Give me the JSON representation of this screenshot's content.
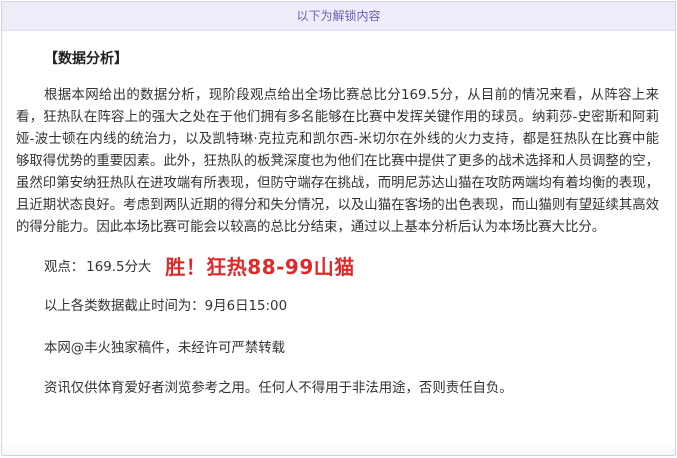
{
  "unlock_banner": "以下为解锁内容",
  "section_title": "【数据分析】",
  "analysis_text": "根据本网给出的数据分析，现阶段观点给出全场比赛总比分169.5分，从目前的情况来看，从阵容上来看，狂热队在阵容上的强大之处在于他们拥有多名能够在比赛中发挥关键作用的球员。纳莉莎-史密斯和阿莉娅-波士顿在内线的统治力，以及凯特琳·克拉克和凯尔西-米切尔在外线的火力支持，都是狂热队在比赛中能够取得优势的重要因素。此外，狂热队的板凳深度也为他们在比赛中提供了更多的战术选择和人员调整的空，虽然印第安纳狂热队在进攻端有所表现，但防守端存在挑战，而明尼苏达山猫在攻防两端均有着均衡的表现，且近期状态良好。考虑到两队近期的得分和失分情况，以及山猫在客场的出色表现，而山猫则有望延续其高效的得分能力。因此本场比赛可能会以较高的总比分结束，通过以上基本分析后认为本场比赛大比分。",
  "pick": {
    "label": "观点：",
    "value": "169.5分大",
    "result": "胜！狂热88-99山猫"
  },
  "data_cutoff": "以上各类数据截止时间为：9月6日15:00",
  "copyright": "本网@丰火独家稿件，未经许可严禁转载",
  "disclaimer": "资讯仅供体育爱好者浏览参考之用。任何人不得用于非法用途，否则责任自负。",
  "colors": {
    "banner_bg": "#efecfa",
    "banner_text": "#6a61b8",
    "result_red": "#e02a2a",
    "body_text": "#333333"
  }
}
